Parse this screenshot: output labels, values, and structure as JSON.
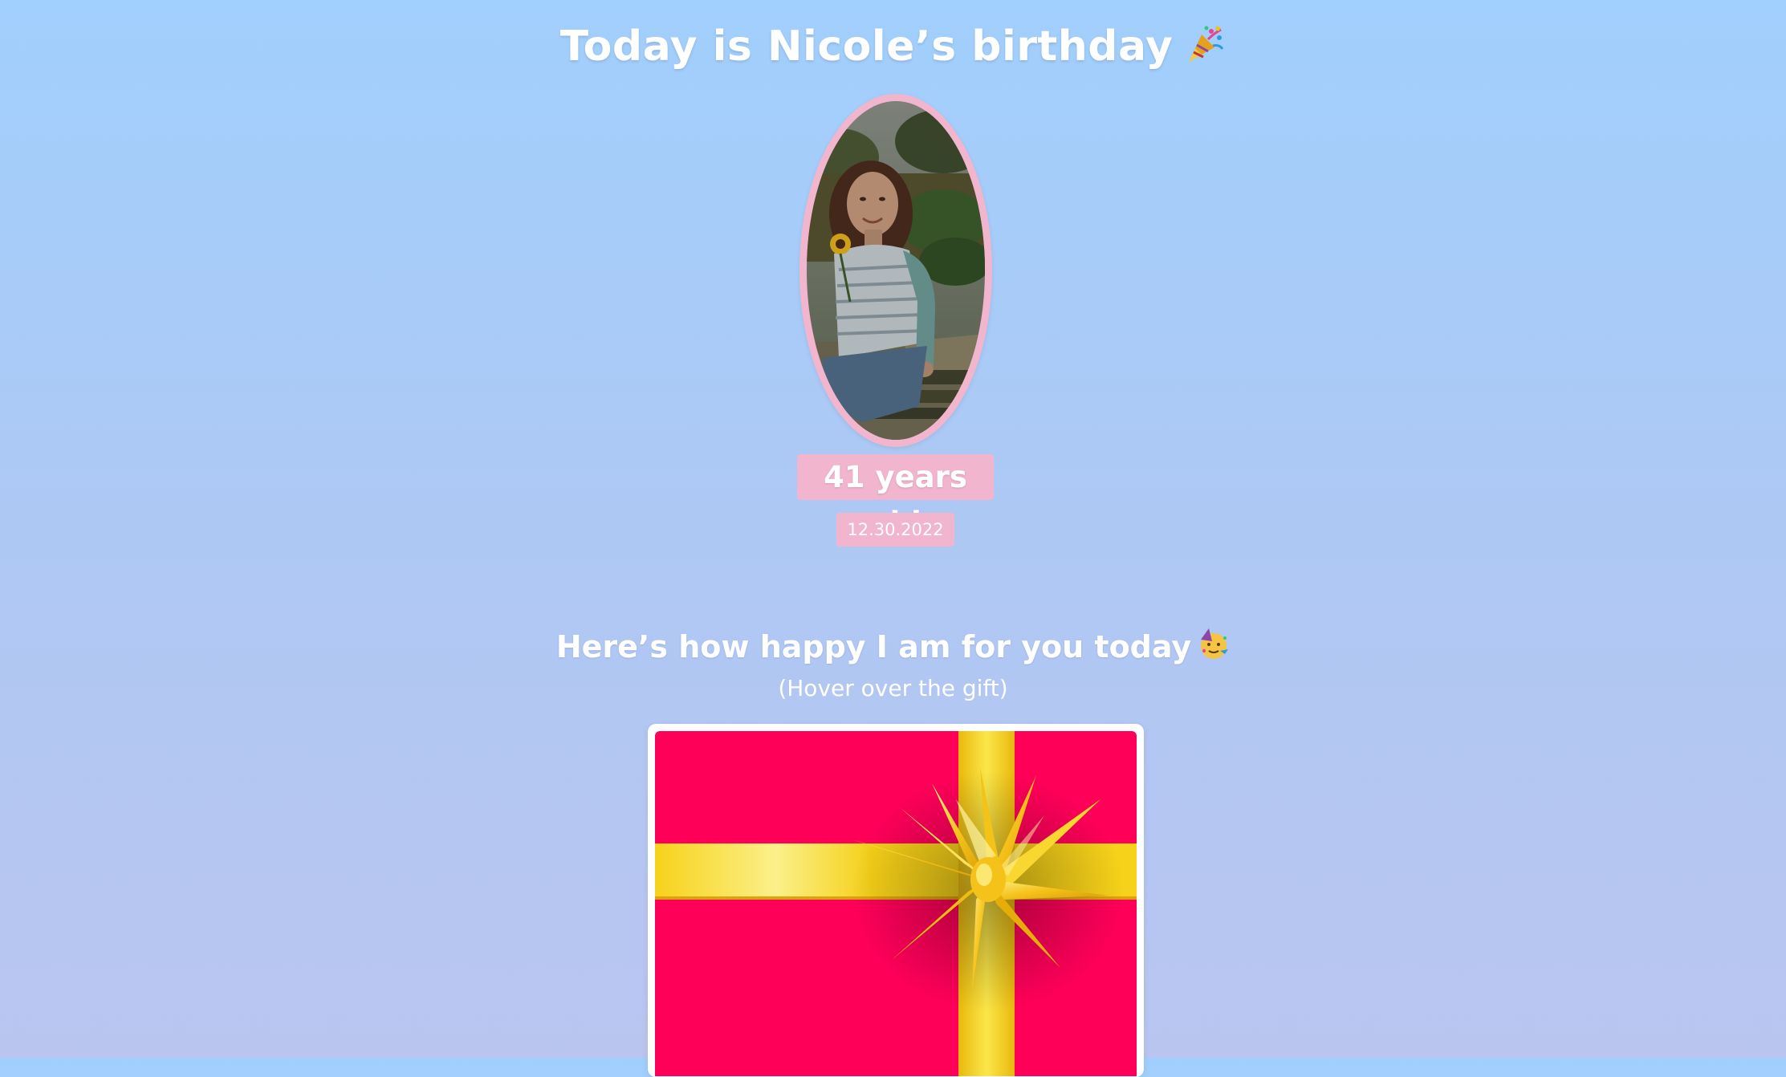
{
  "header": {
    "title": "Today is Nicole’s birthday",
    "title_emoji": "party-popper-icon"
  },
  "profile": {
    "portrait_alt": "Nicole",
    "age_text": "41 years old",
    "date_text": "12.30.2022"
  },
  "gift_section": {
    "heading": "Here’s how happy I am for you today",
    "heading_emoji": "partying-face-icon",
    "hint": "(Hover over the gift)"
  },
  "colors": {
    "background_top": "#a1cffd",
    "background_bottom": "#b9c5ef",
    "badge_pink": "#f1b5cd",
    "gift_red": "#ff0059",
    "ribbon_gold": "#f7d21a"
  }
}
